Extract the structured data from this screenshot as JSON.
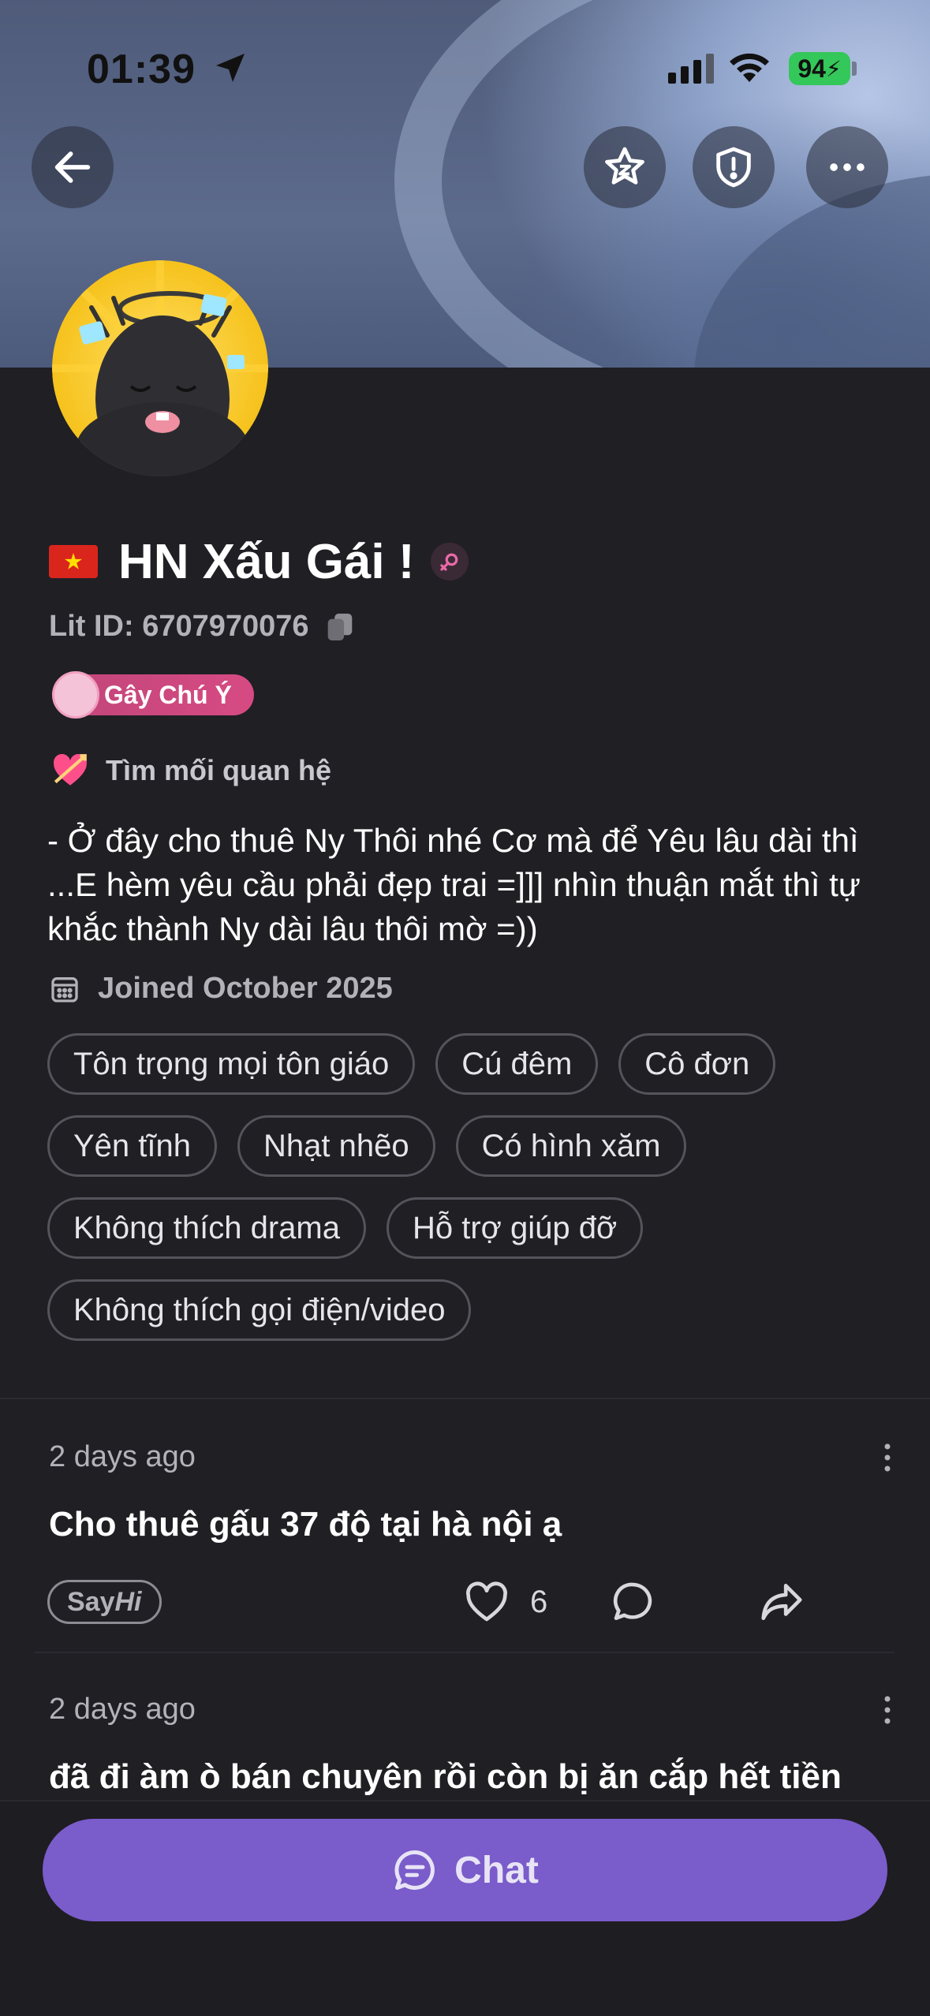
{
  "status_bar": {
    "time": "01:39",
    "battery": "94"
  },
  "header": {
    "back_icon": "arrow-left-icon",
    "actions": [
      "star-badge-icon",
      "shield-alert-icon",
      "more-horizontal-icon"
    ]
  },
  "profile": {
    "name": "HN Xấu Gái !",
    "flag": "vietnam-flag",
    "gender_icon": "female-icon",
    "lit_id": "Lit ID: 6707970076",
    "badge": "Gây Chú Ý",
    "relationship": "Tìm mối quan hệ",
    "bio": "- Ở đây cho thuê Ny Thôi nhé Cơ mà để Yêu lâu dài thì ...E hèm yêu cầu phải đẹp trai =]]] nhìn thuận mắt thì tự khắc thành Ny dài lâu thôi mờ =))",
    "joined": "Joined October 2025",
    "tags": [
      "Tôn trọng mọi tôn giáo",
      "Cú đêm",
      "Cô đơn",
      "Yên tĩnh",
      "Nhạt nhẽo",
      "Có hình xăm",
      "Không thích drama",
      "Hỗ trợ giúp đỡ",
      "Không thích gọi điện/video"
    ]
  },
  "posts": [
    {
      "time": "2 days ago",
      "text": "Cho thuê gấu 37 độ tại hà nội ạ",
      "tag_say": "Say",
      "tag_hi": "Hi",
      "likes": "6"
    },
    {
      "time": "2 days ago",
      "text": "đã đi àm ò bán chuyên rồi còn bị ăn cắp hết tiền"
    }
  ],
  "chat_button": {
    "label": "Chat"
  },
  "colors": {
    "accent": "#7a5ccb",
    "badge": "#d74a83",
    "background": "#201f24"
  }
}
